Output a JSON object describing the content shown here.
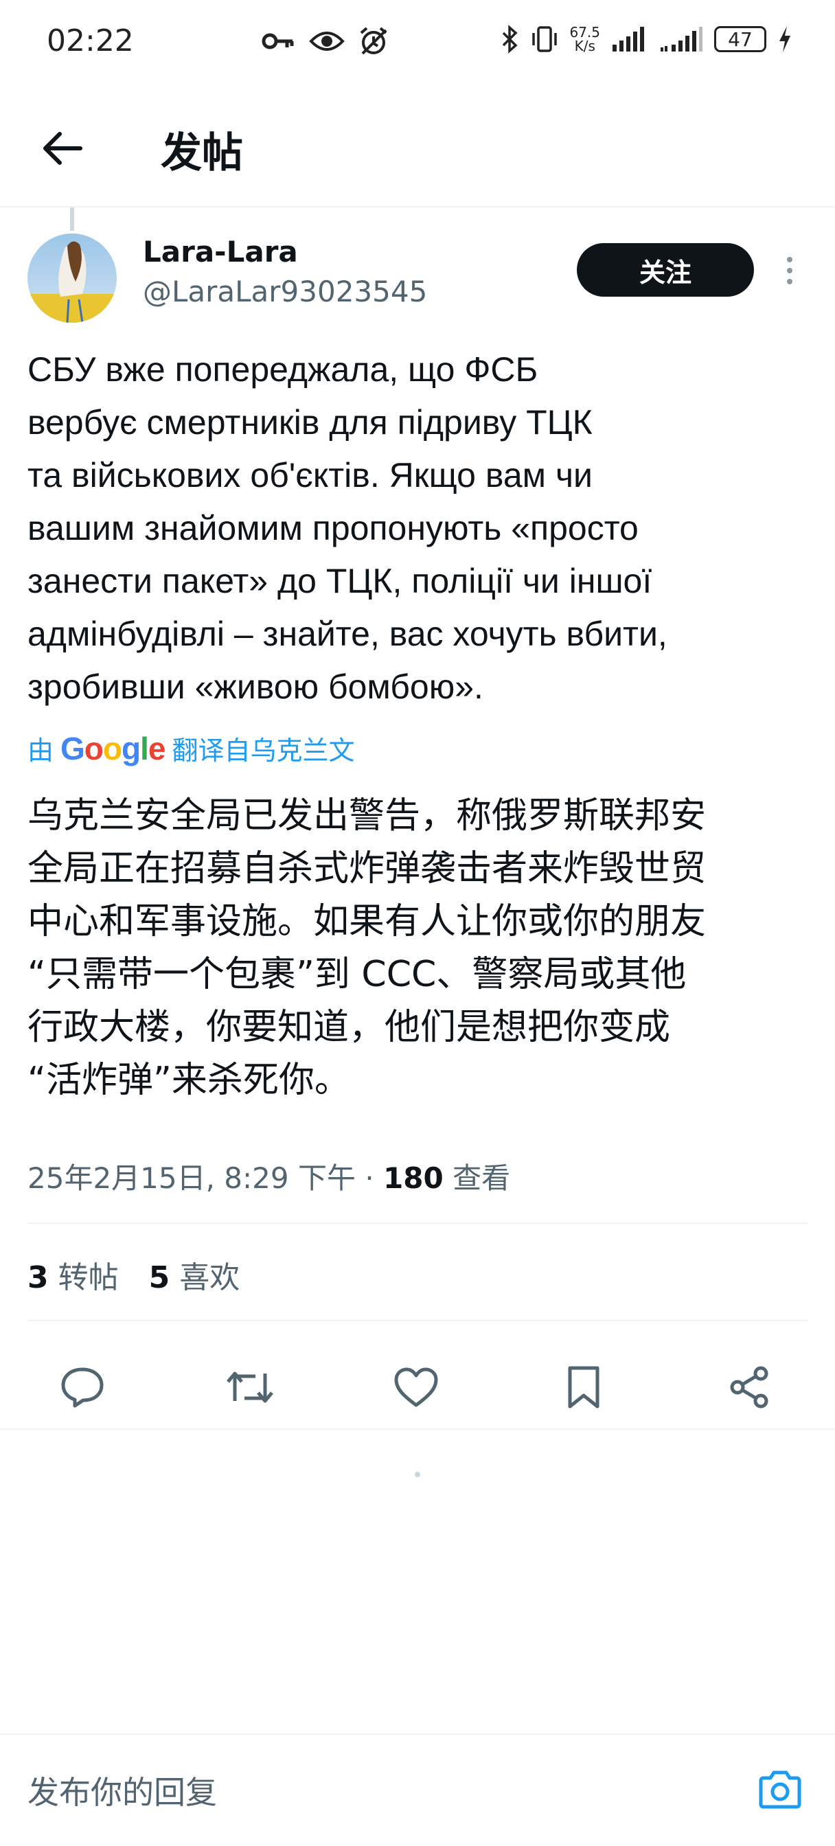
{
  "status_bar": {
    "time": "02:22",
    "net_speed_value": "67.5",
    "net_speed_unit": "K/s",
    "battery": "47",
    "icons": [
      "key-icon",
      "eye-icon",
      "alarm-icon",
      "bluetooth-icon",
      "vibrate-icon",
      "signal-icon",
      "signal-icon",
      "charging-icon"
    ]
  },
  "header": {
    "title": "发帖"
  },
  "post": {
    "author_name": "Lara-Lara",
    "author_handle": "@LaraLar93023545",
    "follow_label": "关注",
    "text": "СБУ вже попереджала, що ФСБ\nвербує смертників для підриву ТЦК\nта військових об'єктів. Якщо вам чи\nвашим знайомим пропонують «просто\nзанести пакет» до ТЦК, поліції чи іншої\nадмінбудівлі – знайте, вас хочуть вбити,\nзробивши «живою бомбою».",
    "translate_prefix": "由",
    "translate_brand": "Google",
    "translate_suffix": "翻译自乌克兰文",
    "translated_text": "乌克兰安全局已发出警告，称俄罗斯联邦安\n全局正在招募自杀式炸弹袭击者来炸毁世贸\n中心和军事设施。如果有人让你或你的朋友\n“只需带一个包裹”到 CCC、警察局或其他\n行政大楼，你要知道，他们是想把你变成\n“活炸弹”来杀死你。",
    "timestamp": "25年2月15日, 8:29 下午",
    "separator": "·",
    "views_count": "180",
    "views_label": "查看",
    "reposts_count": "3",
    "reposts_label": "转帖",
    "likes_count": "5",
    "likes_label": "喜欢"
  },
  "actions": [
    "reply-icon",
    "repost-icon",
    "like-icon",
    "bookmark-icon",
    "share-icon"
  ],
  "reply_bar": {
    "placeholder": "发布你的回复"
  },
  "colors": {
    "accent": "#1d9bf0",
    "text_primary": "#0f1419",
    "text_secondary": "#536471",
    "divider": "#eff3f4"
  }
}
